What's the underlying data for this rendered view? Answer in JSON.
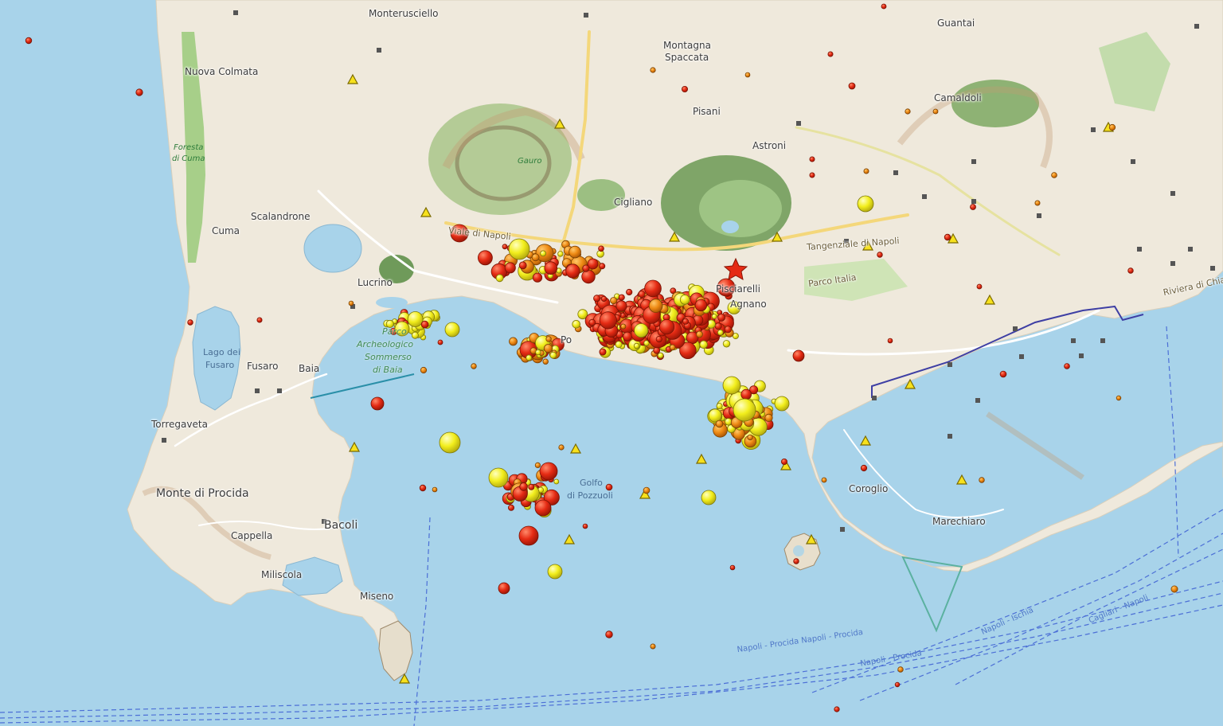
{
  "map": {
    "places": {
      "monterusciello": "Monterusciello",
      "guantai": "Guantai",
      "montagna": "Montagna",
      "spaccata": "Spaccata",
      "nuova_colmata": "Nuova Colmata",
      "pisani": "Pisani",
      "camaldoli": "Camaldoli",
      "astroni": "Astroni",
      "cigliano": "Cigliano",
      "scalandrone": "Scalandrone",
      "cuma": "Cuma",
      "lucrino": "Lucrino",
      "pozzuoli_partial": "Po",
      "pisciarelli_partial": "Pisciarelli",
      "agnano_partial": "Agnano",
      "fusaro": "Fusaro",
      "baia": "Baia",
      "torregaveta": "Torregaveta",
      "monte_di_procida": "Monte di Procida",
      "cappella": "Cappella",
      "bacoli": "Bacoli",
      "miliscola": "Miliscola",
      "miseno": "Miseno",
      "coroglio": "Coroglio",
      "marechiaro": "Marechiaro"
    },
    "water_labels": {
      "lago_line1": "Lago dei",
      "lago_line2": "Fusaro",
      "golfo_line1": "Golfo",
      "golfo_line2": "di Pozzuoli"
    },
    "park_labels": {
      "foresta_line1": "Foresta",
      "foresta_line2": "di Cuma",
      "parco_line1": "Parco",
      "parco_line2": "Archeologico",
      "parco_line3": "Sommerso",
      "parco_line4": "di Baia",
      "gauro": "Gauro"
    },
    "road_labels": {
      "domiziana": "Viale di Napoli",
      "tangenziale": "Tangenziale di Napoli",
      "via_italia": "Parco Italia",
      "riviera": "Riviera di Chiaia"
    },
    "routes": {
      "route_a": "Napoli - Procida  Napoli - Procida",
      "route_b": "Napoli - Procida",
      "route_c": "Cagliari - Napoli",
      "route_d": "Napoli - Ischia"
    },
    "colors": {
      "sea": "#a8d3ea",
      "land": "#efe9dc",
      "park": "#c8d9a4",
      "event_red": "#e52b14",
      "event_orange": "#ee8a14",
      "event_yellow": "#f2ee1c",
      "station_yellow": "#f7e11d",
      "ferry_route": "#4c6fd6"
    },
    "legend_semantics": {
      "circles": "earthquake epicenters, size = magnitude, color = recency",
      "triangles": "seismic monitoring stations"
    }
  }
}
